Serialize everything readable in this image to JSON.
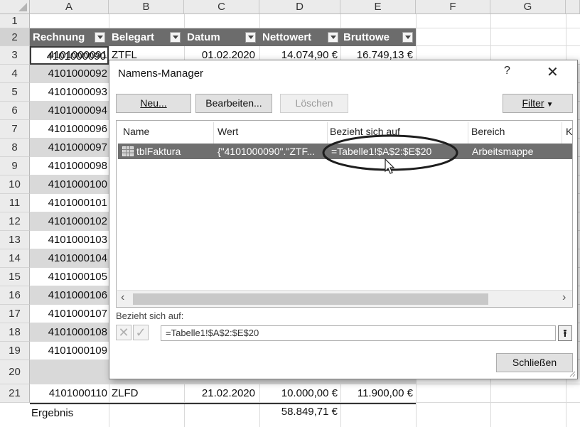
{
  "columns": [
    "A",
    "B",
    "C",
    "D",
    "E",
    "F",
    "G"
  ],
  "row_numbers": [
    "1",
    "2",
    "3",
    "4",
    "5",
    "6",
    "7",
    "8",
    "9",
    "10",
    "11",
    "12",
    "13",
    "14",
    "15",
    "16",
    "17",
    "18",
    "19",
    "20",
    "21"
  ],
  "header_row": {
    "rechnung": "Rechnung",
    "belegart": "Belegart",
    "datum": "Datum",
    "nettowert": "Nettowert",
    "bruttowert": "Bruttowe"
  },
  "row2": {
    "a": "4101000090",
    "b": "ZTFL",
    "c": "01.02.2020",
    "d": "14.074,90 €",
    "e": "16.749,13 €"
  },
  "invoice_numbers": [
    "4101000091",
    "4101000092",
    "4101000093",
    "4101000094",
    "4101000096",
    "4101000097",
    "4101000098",
    "4101000100",
    "4101000101",
    "4101000102",
    "4101000103",
    "4101000104",
    "4101000105",
    "4101000106",
    "4101000107",
    "4101000108",
    "4101000109"
  ],
  "row20": {
    "a": "4101000110",
    "b": "ZLFD",
    "c": "21.02.2020",
    "d": "10.000,00 €",
    "e": "11.900,00 €"
  },
  "row21": {
    "a": "Ergebnis",
    "d": "58.849,71 €"
  },
  "dialog": {
    "title": "Namens-Manager",
    "help": "?",
    "close": "✕",
    "buttons": {
      "new": "Neu...",
      "edit": "Bearbeiten...",
      "delete": "Löschen",
      "filter": "Filter"
    },
    "list_headers": {
      "name": "Name",
      "value": "Wert",
      "refers_to": "Bezieht sich auf",
      "scope": "Bereich",
      "comment": "K"
    },
    "entry": {
      "name": "tblFaktura",
      "value": "{\"4101000090\".\"ZTF...",
      "refers_to": "=Tabelle1!$A$2:$E$20",
      "scope": "Arbeitsmappe"
    },
    "refers_to_label": "Bezieht sich auf:",
    "refers_to_value": "=Tabelle1!$A$2:$E$20",
    "close_button": "Schließen"
  },
  "colors": {
    "table_header_bg": "#6c6c6c",
    "band_row_bg": "#d9d9d9",
    "selected_entry_bg": "#6f6f6f"
  }
}
